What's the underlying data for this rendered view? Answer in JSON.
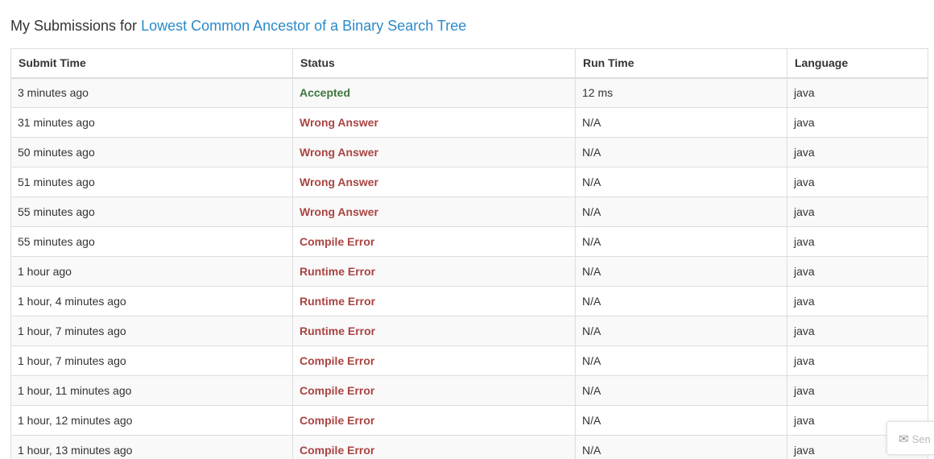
{
  "header": {
    "prefix": "My Submissions for",
    "problem_link": "Lowest Common Ancestor of a Binary Search Tree"
  },
  "table": {
    "columns": [
      "Submit Time",
      "Status",
      "Run Time",
      "Language"
    ],
    "rows": [
      {
        "time": "3 minutes ago",
        "status": "Accepted",
        "run_time": "12 ms",
        "language": "java"
      },
      {
        "time": "31 minutes ago",
        "status": "Wrong Answer",
        "run_time": "N/A",
        "language": "java"
      },
      {
        "time": "50 minutes ago",
        "status": "Wrong Answer",
        "run_time": "N/A",
        "language": "java"
      },
      {
        "time": "51 minutes ago",
        "status": "Wrong Answer",
        "run_time": "N/A",
        "language": "java"
      },
      {
        "time": "55 minutes ago",
        "status": "Wrong Answer",
        "run_time": "N/A",
        "language": "java"
      },
      {
        "time": "55 minutes ago",
        "status": "Compile Error",
        "run_time": "N/A",
        "language": "java"
      },
      {
        "time": "1 hour ago",
        "status": "Runtime Error",
        "run_time": "N/A",
        "language": "java"
      },
      {
        "time": "1 hour, 4 minutes ago",
        "status": "Runtime Error",
        "run_time": "N/A",
        "language": "java"
      },
      {
        "time": "1 hour, 7 minutes ago",
        "status": "Runtime Error",
        "run_time": "N/A",
        "language": "java"
      },
      {
        "time": "1 hour, 7 minutes ago",
        "status": "Compile Error",
        "run_time": "N/A",
        "language": "java"
      },
      {
        "time": "1 hour, 11 minutes ago",
        "status": "Compile Error",
        "run_time": "N/A",
        "language": "java"
      },
      {
        "time": "1 hour, 12 minutes ago",
        "status": "Compile Error",
        "run_time": "N/A",
        "language": "java"
      },
      {
        "time": "1 hour, 13 minutes ago",
        "status": "Compile Error",
        "run_time": "N/A",
        "language": "java"
      }
    ]
  },
  "feedback": {
    "icon": "envelope-icon",
    "label": "Sen"
  },
  "colors": {
    "link": "#2a8acb",
    "accepted": "#3c763d",
    "error": "#a94442"
  }
}
